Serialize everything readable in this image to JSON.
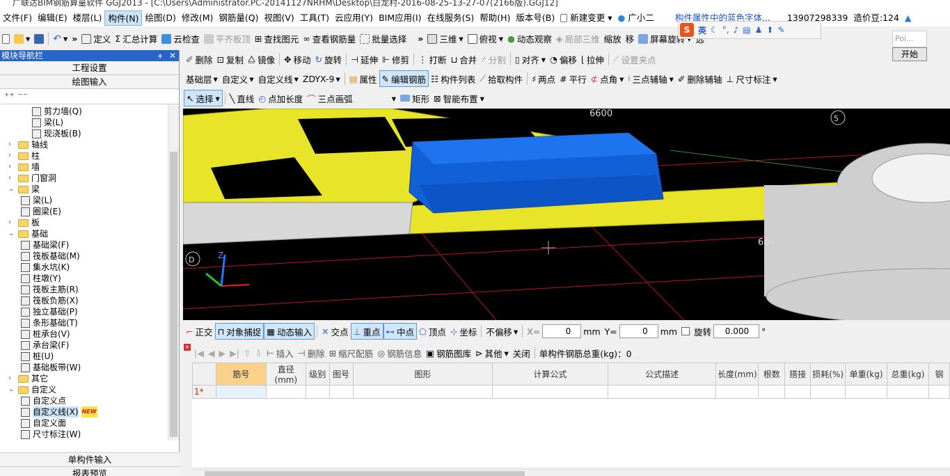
{
  "title": "广联达BIM钢筋算量软件 GGJ2013 - [C:\\Users\\Administrator.PC-20141127NRHM\\Desktop\\白龙村-2016-08-25-13-27-07(2166版).GGJ12]",
  "menu": {
    "items": [
      "文件(F)",
      "编辑(E)",
      "楼层(L)",
      "构件(N)",
      "绘图(D)",
      "修改(M)",
      "钢筋量(Q)",
      "视图(V)",
      "工具(T)",
      "云应用(Y)",
      "BIM应用(I)",
      "在线服务(S)",
      "帮助(H)",
      "版本号(B)"
    ],
    "active": "构件(N)",
    "new_change": "新建变更",
    "assistant": "广小二",
    "notice": "构件属性中的蓝色字体...",
    "phone": "13907298339",
    "price": "造价豆:124"
  },
  "toolbar1": {
    "items": [
      "定义",
      "汇总计算",
      "云检查",
      "平齐板顶",
      "查找图元",
      "查看钢筋量",
      "批量选择",
      "三维",
      "俯视",
      "动态观察",
      "局部三维",
      "缩放",
      "移",
      "屏幕旋转",
      "选"
    ]
  },
  "ime": {
    "label": "英"
  },
  "popup": {
    "text": "Poi...",
    "button": "开始"
  },
  "sidebar": {
    "title": "模块导航栏",
    "project_settings": "工程设置",
    "drawing_input": "绘图输入",
    "single_input": "单构件输入",
    "report_preview": "报表预览",
    "tree": [
      {
        "level": 2,
        "label": "剪力墙(Q)",
        "icon": "wall-icon"
      },
      {
        "level": 2,
        "label": "梁(L)",
        "icon": "beam-icon"
      },
      {
        "level": 2,
        "label": "现浇板(B)",
        "icon": "slab-icon"
      },
      {
        "level": 0,
        "label": "轴线",
        "expand": ">"
      },
      {
        "level": 0,
        "label": "柱",
        "expand": ">"
      },
      {
        "level": 0,
        "label": "墙",
        "expand": ">"
      },
      {
        "level": 0,
        "label": "门窗洞",
        "expand": ">"
      },
      {
        "level": 0,
        "label": "梁",
        "expand": "v"
      },
      {
        "level": 1,
        "label": "梁(L)",
        "icon": "beam-icon"
      },
      {
        "level": 1,
        "label": "圈梁(E)",
        "icon": "ring-beam-icon"
      },
      {
        "level": 0,
        "label": "板",
        "expand": ">"
      },
      {
        "level": 0,
        "label": "基础",
        "expand": "v"
      },
      {
        "level": 1,
        "label": "基础梁(F)",
        "icon": "foundation-beam-icon"
      },
      {
        "level": 1,
        "label": "筏板基础(M)",
        "icon": "raft-icon"
      },
      {
        "level": 1,
        "label": "集水坑(K)",
        "icon": "sump-icon"
      },
      {
        "level": 1,
        "label": "柱墩(Y)",
        "icon": "pier-icon"
      },
      {
        "level": 1,
        "label": "筏板主筋(R)",
        "icon": "raft-main-rebar-icon"
      },
      {
        "level": 1,
        "label": "筏板负筋(X)",
        "icon": "raft-neg-rebar-icon"
      },
      {
        "level": 1,
        "label": "独立基础(P)",
        "icon": "isolated-footing-icon"
      },
      {
        "level": 1,
        "label": "条形基础(T)",
        "icon": "strip-footing-icon"
      },
      {
        "level": 1,
        "label": "桩承台(V)",
        "icon": "pile-cap-icon"
      },
      {
        "level": 1,
        "label": "承台梁(F)",
        "icon": "cap-beam-icon"
      },
      {
        "level": 1,
        "label": "桩(U)",
        "icon": "pile-icon"
      },
      {
        "level": 1,
        "label": "基础板带(W)",
        "icon": "foundation-strip-icon"
      },
      {
        "level": 0,
        "label": "其它",
        "expand": ">"
      },
      {
        "level": 0,
        "label": "自定义",
        "expand": "v"
      },
      {
        "level": 1,
        "label": "自定义点",
        "icon": "custom-point-icon"
      },
      {
        "level": 1,
        "label": "自定义线(X)",
        "icon": "custom-line-icon",
        "badge": "NEW"
      },
      {
        "level": 1,
        "label": "自定义面",
        "icon": "custom-face-icon"
      },
      {
        "level": 1,
        "label": "尺寸标注(W)",
        "icon": "dimension-icon"
      }
    ]
  },
  "toolbar2": {
    "items": [
      "删除",
      "复制",
      "镜像",
      "移动",
      "旋转",
      "延伸",
      "修剪",
      "打断",
      "合并",
      "分割",
      "对齐",
      "偏移",
      "拉伸",
      "设置夹点"
    ]
  },
  "toolbar3": {
    "layer": "基础层",
    "type": "自定义",
    "sub_type": "自定义线",
    "component": "ZDYX-9",
    "items": [
      "属性",
      "编辑钢筋",
      "构件列表",
      "拾取构件",
      "两点",
      "平行",
      "点角",
      "三点辅轴",
      "删除辅轴",
      "尺寸标注"
    ]
  },
  "toolbar4": {
    "items": [
      "选择",
      "直线",
      "点加长度",
      "三点画弧",
      "矩形",
      "智能布置"
    ]
  },
  "canvas": {
    "labels": [
      "6600",
      "5",
      "D",
      "66"
    ],
    "axis_z": "Z"
  },
  "snap": {
    "items": [
      "正交",
      "对象捕捉",
      "动态输入",
      "交点",
      "重点",
      "中点",
      "顶点",
      "坐标"
    ],
    "offset_mode": "不偏移",
    "x_label": "X=",
    "x_value": "0",
    "y_label": "Y=",
    "y_value": "0",
    "unit": "mm",
    "rotate_label": "旋转",
    "rotate_value": "0.000",
    "degree": "°"
  },
  "rebar_toolbar": {
    "items": [
      "插入",
      "删除",
      "缩尺配筋",
      "钢筋信息",
      "钢筋图库",
      "其他",
      "关闭"
    ],
    "total": "单构件钢筋总重(kg)：0"
  },
  "grid": {
    "columns": [
      "筋号",
      "直径(mm)",
      "级别",
      "图号",
      "图形",
      "计算公式",
      "公式描述",
      "长度(mm)",
      "根数",
      "搭接",
      "损耗(%)",
      "单重(kg)",
      "总重(kg)",
      "钢"
    ],
    "row_header": "1*"
  }
}
